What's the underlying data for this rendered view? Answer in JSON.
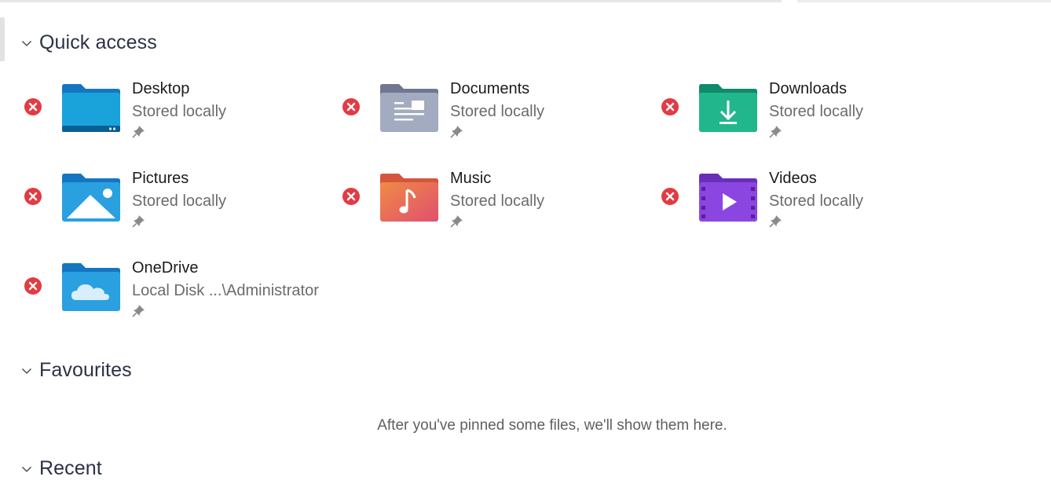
{
  "quick_access": {
    "title": "Quick access",
    "items": [
      {
        "name": "Desktop",
        "location": "Stored locally",
        "icon": "desktop-folder-icon"
      },
      {
        "name": "Documents",
        "location": "Stored locally",
        "icon": "documents-folder-icon"
      },
      {
        "name": "Downloads",
        "location": "Stored locally",
        "icon": "downloads-folder-icon"
      },
      {
        "name": "Pictures",
        "location": "Stored locally",
        "icon": "pictures-folder-icon"
      },
      {
        "name": "Music",
        "location": "Stored locally",
        "icon": "music-folder-icon"
      },
      {
        "name": "Videos",
        "location": "Stored locally",
        "icon": "videos-folder-icon"
      },
      {
        "name": "OneDrive",
        "location": "Local Disk ...\\Administrator",
        "icon": "onedrive-folder-icon"
      }
    ]
  },
  "favourites": {
    "title": "Favourites",
    "empty_message": "After you've pinned some files, we'll show them here."
  },
  "recent": {
    "title": "Recent"
  },
  "colors": {
    "unpin_red": "#e23b44",
    "header_text": "#2a3245",
    "secondary_text": "#6b6b6b"
  }
}
